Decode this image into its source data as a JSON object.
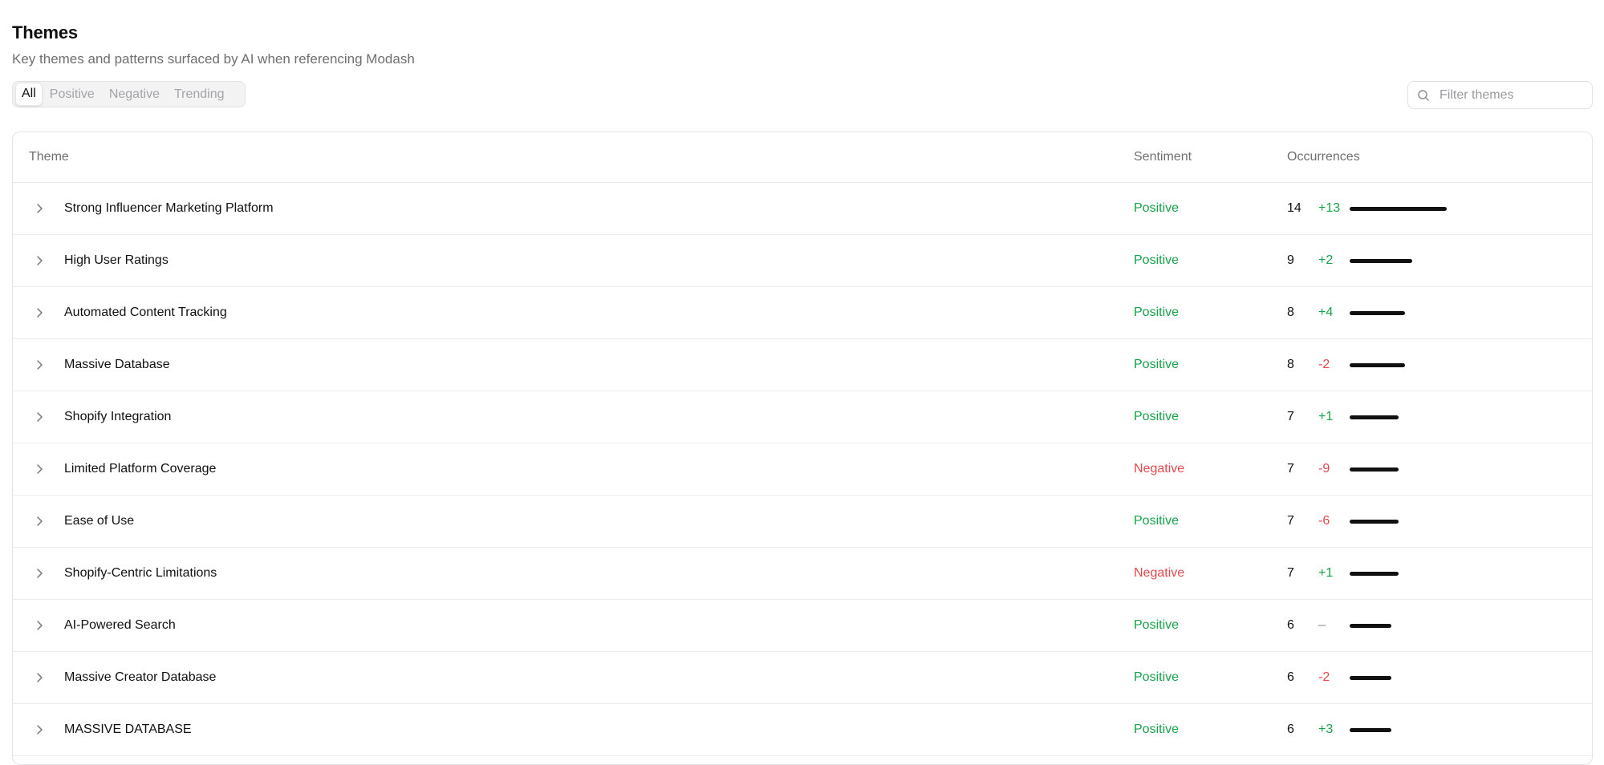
{
  "header": {
    "title": "Themes",
    "subtitle": "Key themes and patterns surfaced by AI when referencing Modash"
  },
  "tabs": [
    {
      "label": "All",
      "active": true
    },
    {
      "label": "Positive",
      "active": false
    },
    {
      "label": "Negative",
      "active": false
    },
    {
      "label": "Trending",
      "active": false
    }
  ],
  "filter": {
    "placeholder": "Filter themes",
    "value": ""
  },
  "table": {
    "columns": {
      "theme": "Theme",
      "sentiment": "Sentiment",
      "occurrences": "Occurrences"
    },
    "max_occurrences": 14,
    "rows": [
      {
        "theme": "Strong Influencer Marketing Platform",
        "sentiment": "Positive",
        "count": 14,
        "delta": "+13"
      },
      {
        "theme": "High User Ratings",
        "sentiment": "Positive",
        "count": 9,
        "delta": "+2"
      },
      {
        "theme": "Automated Content Tracking",
        "sentiment": "Positive",
        "count": 8,
        "delta": "+4"
      },
      {
        "theme": "Massive Database",
        "sentiment": "Positive",
        "count": 8,
        "delta": "-2"
      },
      {
        "theme": "Shopify Integration",
        "sentiment": "Positive",
        "count": 7,
        "delta": "+1"
      },
      {
        "theme": "Limited Platform Coverage",
        "sentiment": "Negative",
        "count": 7,
        "delta": "-9"
      },
      {
        "theme": "Ease of Use",
        "sentiment": "Positive",
        "count": 7,
        "delta": "-6"
      },
      {
        "theme": "Shopify-Centric Limitations",
        "sentiment": "Negative",
        "count": 7,
        "delta": "+1"
      },
      {
        "theme": "AI-Powered Search",
        "sentiment": "Positive",
        "count": 6,
        "delta": "–"
      },
      {
        "theme": "Massive Creator Database",
        "sentiment": "Positive",
        "count": 6,
        "delta": "-2"
      },
      {
        "theme": "MASSIVE DATABASE",
        "sentiment": "Positive",
        "count": 6,
        "delta": "+3"
      }
    ]
  },
  "colors": {
    "positive": "#16a34a",
    "negative": "#e5484d",
    "neutral": "#8a8a8f",
    "bar": "#111111"
  },
  "icons": {
    "row_expand": "chevron-right-icon",
    "filter": "search-icon"
  }
}
